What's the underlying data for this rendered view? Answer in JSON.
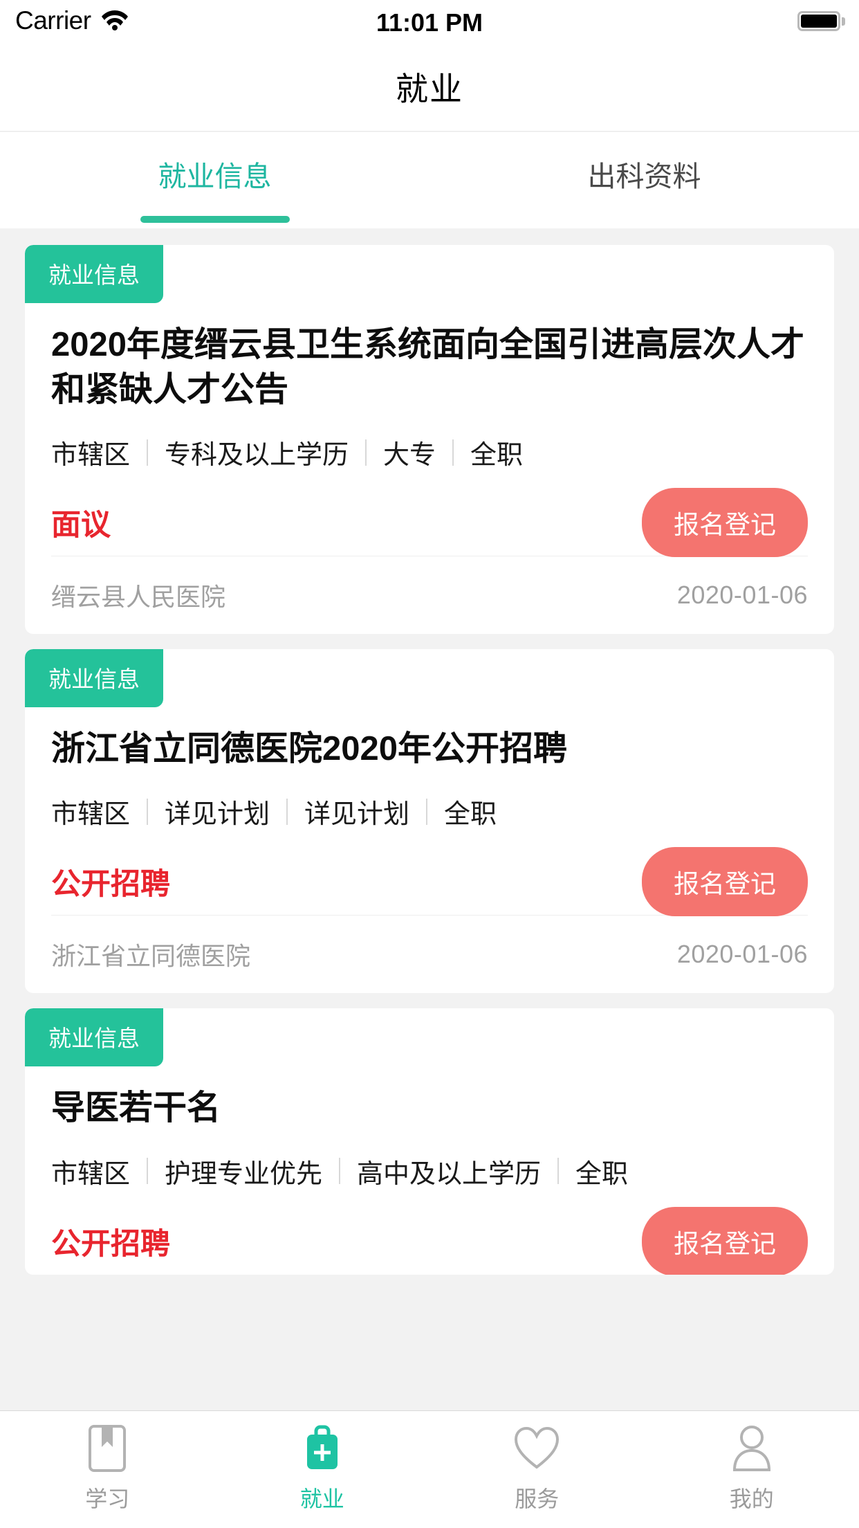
{
  "statusbar": {
    "carrier": "Carrier",
    "wifi_icon": "wifi-icon",
    "time": "11:01 PM",
    "battery_icon": "battery-icon"
  },
  "navbar": {
    "title": "就业"
  },
  "tabs": [
    {
      "label": "就业信息",
      "active": true
    },
    {
      "label": "出科资料",
      "active": false
    }
  ],
  "colors": {
    "accent_teal": "#1eb6a0",
    "badge_green": "#24c29a",
    "underline_green": "#2ec09a",
    "price_red": "#e8252e",
    "button_salmon": "#f4746f",
    "page_bg": "#f2f2f2",
    "muted_gray": "#a0a0a0"
  },
  "cards": [
    {
      "badge": "就业信息",
      "title": "2020年度缙云县卫生系统面向全国引进高层次人才和紧缺人才公告",
      "tags": [
        "市辖区",
        "专科及以上学历",
        "大专",
        "全职"
      ],
      "price": "面议",
      "action_label": "报名登记",
      "org": "缙云县人民医院",
      "date": "2020-01-06"
    },
    {
      "badge": "就业信息",
      "title": "浙江省立同德医院2020年公开招聘",
      "tags": [
        "市辖区",
        "详见计划",
        "详见计划",
        "全职"
      ],
      "price": "公开招聘",
      "action_label": "报名登记",
      "org": "浙江省立同德医院",
      "date": "2020-01-06"
    },
    {
      "badge": "就业信息",
      "title": "导医若干名",
      "tags": [
        "市辖区",
        "护理专业优先",
        "高中及以上学历",
        "全职"
      ],
      "price": "公开招聘",
      "action_label": "报名登记",
      "org": "",
      "date": ""
    }
  ],
  "bottomnav": [
    {
      "label": "学习",
      "icon": "book-bookmark-icon",
      "active": false
    },
    {
      "label": "就业",
      "icon": "briefcase-plus-icon",
      "active": true
    },
    {
      "label": "服务",
      "icon": "heart-icon",
      "active": false
    },
    {
      "label": "我的",
      "icon": "person-icon",
      "active": false
    }
  ]
}
